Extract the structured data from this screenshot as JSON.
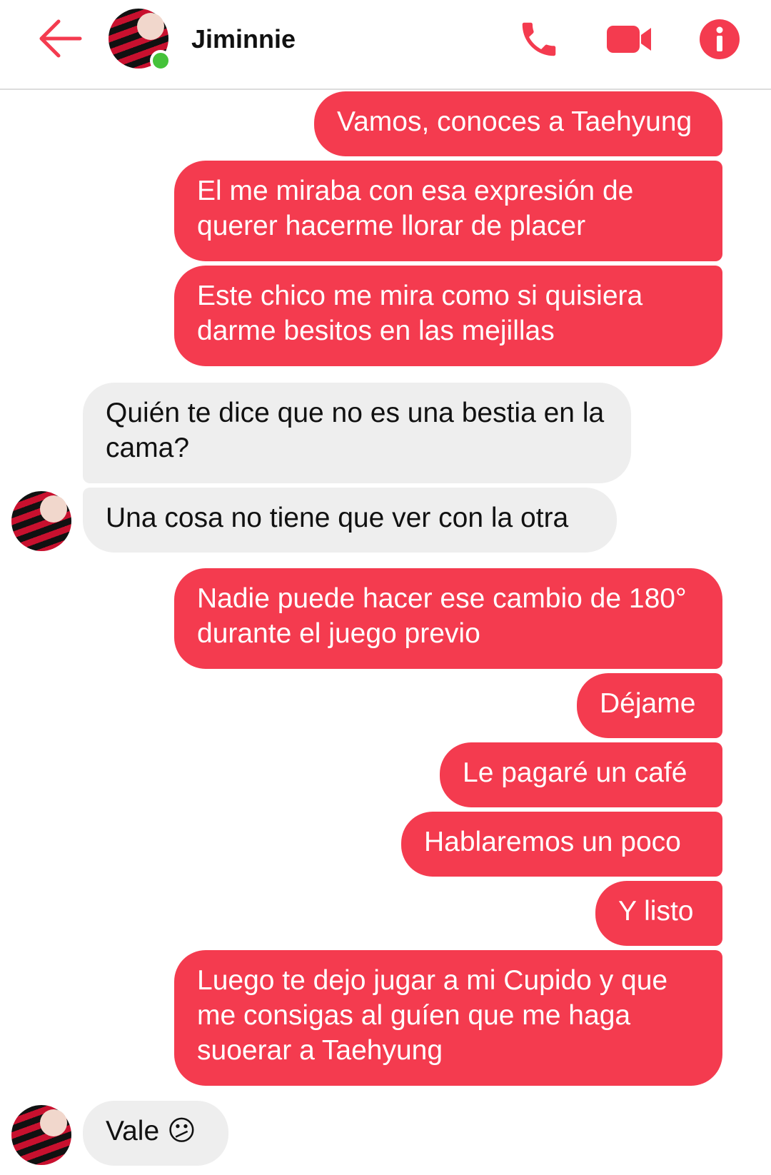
{
  "header": {
    "contact_name": "Jiminnie",
    "online": true
  },
  "colors": {
    "accent": "#f43b4f",
    "incoming_bubble": "#eeeeee",
    "online_dot": "#45c23a"
  },
  "icons": {
    "back": "arrow-left-icon",
    "call": "phone-icon",
    "video": "video-camera-icon",
    "info": "info-icon"
  },
  "messages": [
    {
      "side": "out",
      "text": "Vamos, conoces a Taehyung"
    },
    {
      "side": "out",
      "text": "El me miraba con esa expresión de querer hacerme llorar de placer"
    },
    {
      "side": "out",
      "text": "Este chico me mira como si quisiera darme besitos en las mejillas"
    },
    {
      "side": "in",
      "text": "Quién te dice que no es una bestia en la cama?"
    },
    {
      "side": "in",
      "text": "Una cosa no tiene que ver con la otra"
    },
    {
      "side": "out",
      "text": "Nadie puede hacer ese cambio de 180° durante el juego previo"
    },
    {
      "side": "out",
      "text": "Déjame"
    },
    {
      "side": "out",
      "text": "Le pagaré un café"
    },
    {
      "side": "out",
      "text": "Hablaremos un poco"
    },
    {
      "side": "out",
      "text": "Y listo"
    },
    {
      "side": "out",
      "text": "Luego te dejo jugar a mi Cupido y que me consigas al guíen que me haga suoerar a Taehyung"
    },
    {
      "side": "in",
      "text": "Vale",
      "emoji": "😕"
    }
  ]
}
